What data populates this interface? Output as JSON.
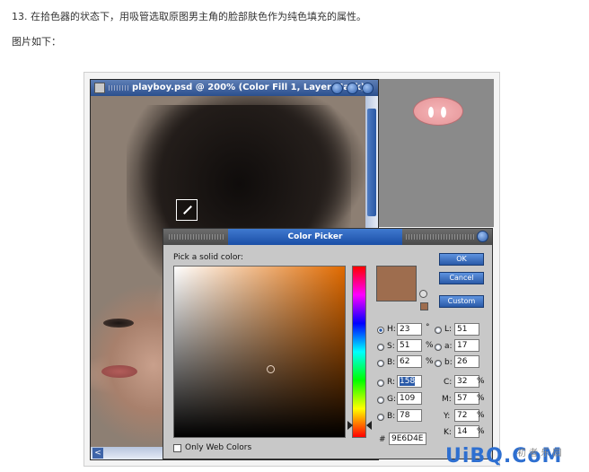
{
  "intro": {
    "line1": "13. 在拾色器的状态下，用吸管选取原图男主角的脸部肤色作为纯色填充的属性。",
    "line2": "图片如下："
  },
  "psd_window": {
    "title": "playboy.psd @ 200% (Color Fill 1, Layer Mask)"
  },
  "color_picker": {
    "title": "Color Picker",
    "pick_label": "Pick a solid color:",
    "buttons": {
      "ok": "OK",
      "cancel": "Cancel",
      "custom": "Custom"
    },
    "hsb": [
      {
        "label": "H:",
        "value": "23",
        "unit": "°",
        "selected": true
      },
      {
        "label": "S:",
        "value": "51",
        "unit": "%",
        "selected": false
      },
      {
        "label": "B:",
        "value": "62",
        "unit": "%",
        "selected": false
      }
    ],
    "rgb": [
      {
        "label": "R:",
        "value": "158",
        "selected": false
      },
      {
        "label": "G:",
        "value": "109",
        "selected": false
      },
      {
        "label": "B:",
        "value": "78",
        "selected": false
      }
    ],
    "lab": [
      {
        "label": "L:",
        "value": "51"
      },
      {
        "label": "a:",
        "value": "17"
      },
      {
        "label": "b:",
        "value": "26"
      }
    ],
    "cmyk": [
      {
        "label": "C:",
        "value": "32",
        "unit": "%"
      },
      {
        "label": "M:",
        "value": "57",
        "unit": "%"
      },
      {
        "label": "Y:",
        "value": "72",
        "unit": "%"
      },
      {
        "label": "K:",
        "value": "14",
        "unit": "%"
      }
    ],
    "hex_label": "#",
    "hex_value": "9E6D4E",
    "web_colors_label": "Only Web Colors",
    "current_color": "#9E6D4E"
  },
  "watermark": {
    "main": "UiBQ.CoM",
    "sub": "初 者 乐 园"
  },
  "colors": {
    "title_blue": "#2a5aa8",
    "panel_gray": "#c8c8c8"
  }
}
